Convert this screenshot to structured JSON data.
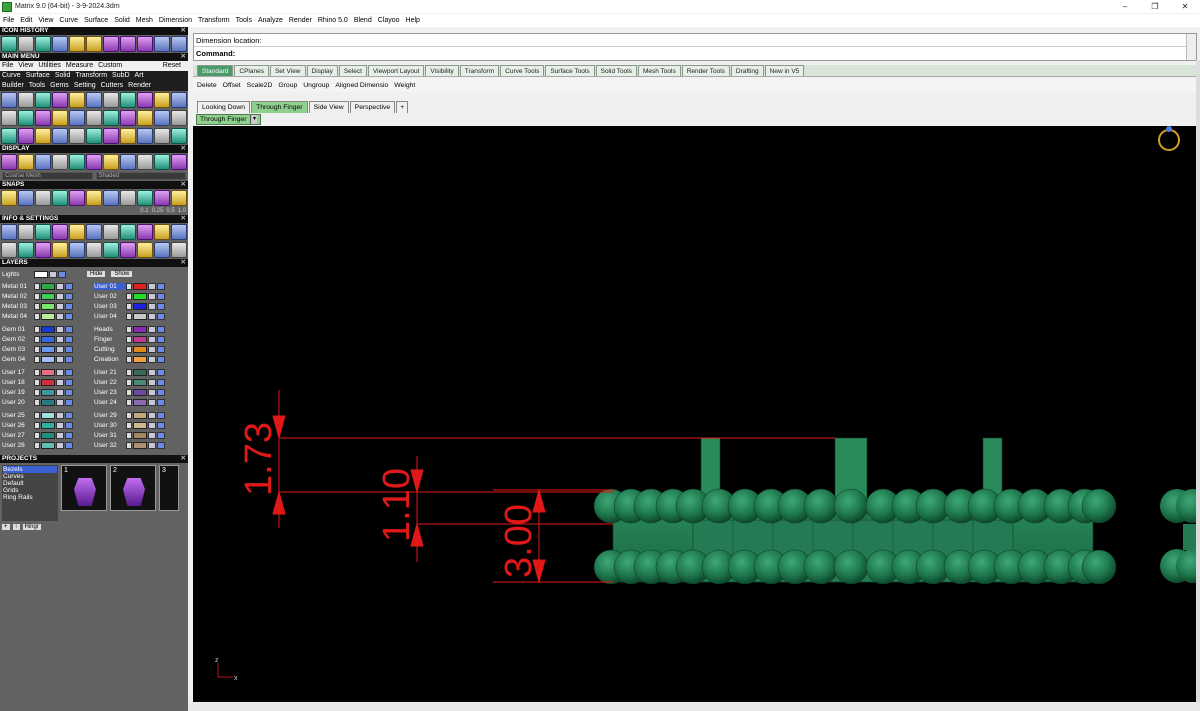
{
  "window": {
    "title": "Matrix 9.0 (64-bit) - 3-9-2024.3dm",
    "controls": [
      "–",
      "❐",
      "✕"
    ]
  },
  "menubar": [
    "File",
    "Edit",
    "View",
    "Curve",
    "Surface",
    "Solid",
    "Mesh",
    "Dimension",
    "Transform",
    "Tools",
    "Analyze",
    "Render",
    "Rhino 5.0",
    "Blend",
    "Clayoo",
    "Help"
  ],
  "left": {
    "icon_history": "ICON HISTORY",
    "main_menu": "MAIN MENU",
    "main_menu_items": [
      "File",
      "View",
      "Utilities",
      "Measure",
      "Custom"
    ],
    "reset": "Reset",
    "main_menu_row2": [
      "Curve",
      "Surface",
      "Solid",
      "Transform",
      "SubD",
      "Art"
    ],
    "main_menu_row3": [
      "Builder",
      "Tools",
      "Gems",
      "Setting",
      "Cutters",
      "Render"
    ],
    "display": "DISPLAY",
    "display_mesh": "Coarse Mesh",
    "display_shade": "Shaded",
    "snaps": "SNAPS",
    "snap_values": [
      "0.1",
      "0.25",
      "0.5",
      "1.0"
    ],
    "info_settings": "INFO & SETTINGS",
    "layers": "LAYERS",
    "lights": "Lights",
    "hide": "Hide",
    "show": "Show",
    "layer_groups": [
      {
        "left": [
          "Metal 01",
          "Metal 02",
          "Metal 03",
          "Metal 04"
        ],
        "right": [
          "User 01",
          "User 02",
          "User 03",
          "User 04"
        ],
        "lcolors": [
          "#2faa4a",
          "#3ccf5a",
          "#7ae870",
          "#b8f0a0"
        ],
        "rcolors": [
          "#e02020",
          "#20e020",
          "#2020e0",
          "#c8c8c8"
        ]
      },
      {
        "left": [
          "Gem 01",
          "Gem 02",
          "Gem 03",
          "Gem 04"
        ],
        "right": [
          "Heads",
          "Finger",
          "Cutting",
          "Creation"
        ],
        "lcolors": [
          "#1a3ad0",
          "#3a6ae8",
          "#6a9af0",
          "#a0c0f8"
        ],
        "rcolors": [
          "#8a2ab0",
          "#c03a90",
          "#e08a20",
          "#f0a040"
        ]
      },
      {
        "left": [
          "User 17",
          "User 18",
          "User 19",
          "User 20"
        ],
        "right": [
          "User 21",
          "User 22",
          "User 23",
          "User 24"
        ],
        "lcolors": [
          "#e87080",
          "#d03040",
          "#3a9aa0",
          "#2a7a80"
        ],
        "rcolors": [
          "#3a6a5a",
          "#4a8a7a",
          "#6a4aa0",
          "#8a6ab0"
        ]
      },
      {
        "left": [
          "User 25",
          "User 26",
          "User 27",
          "User 28"
        ],
        "right": [
          "User 29",
          "User 30",
          "User 31",
          "User 32"
        ],
        "lcolors": [
          "#a0e0e0",
          "#30b0a0",
          "#209080",
          "#60c0b0"
        ],
        "rcolors": [
          "#c0a880",
          "#d0b890",
          "#a08860",
          "#b09070"
        ]
      }
    ],
    "projects": "PROJECTS",
    "project_list": [
      "Bezels",
      "Curves",
      "Default",
      "Grids",
      "Ring Rails"
    ],
    "project_thumbs": [
      "1",
      "2",
      "3"
    ],
    "hinge_btn": "Hingr"
  },
  "command": {
    "prompt1": "Dimension location:",
    "prompt2": "Command:"
  },
  "toolbar_tabs": [
    "Standard",
    "CPlanes",
    "Set View",
    "Display",
    "Select",
    "Viewport Layout",
    "Visibility",
    "Transform",
    "Curve Tools",
    "Surface Tools",
    "Solid Tools",
    "Mesh Tools",
    "Render Tools",
    "Drafting",
    "New in V5"
  ],
  "toolbar_cmds": [
    "Delete",
    "Offset",
    "Scale2D",
    "Group",
    "Ungroup",
    "Aligned Dimensio",
    "Weight"
  ],
  "viewport_tabs": [
    "Looking Down",
    "Through Finger",
    "Side View",
    "Perspective"
  ],
  "active_viewport": "Through Finger",
  "dimensions": [
    {
      "value": "1.73"
    },
    {
      "value": "1.10"
    },
    {
      "value": "3.00"
    }
  ],
  "axis": {
    "z": "z",
    "x": "x"
  },
  "colors": {
    "dimension": "#e01818",
    "model": "#1f7a4e",
    "viewport_bg": "#000000",
    "active_tab": "#8fd08f"
  }
}
